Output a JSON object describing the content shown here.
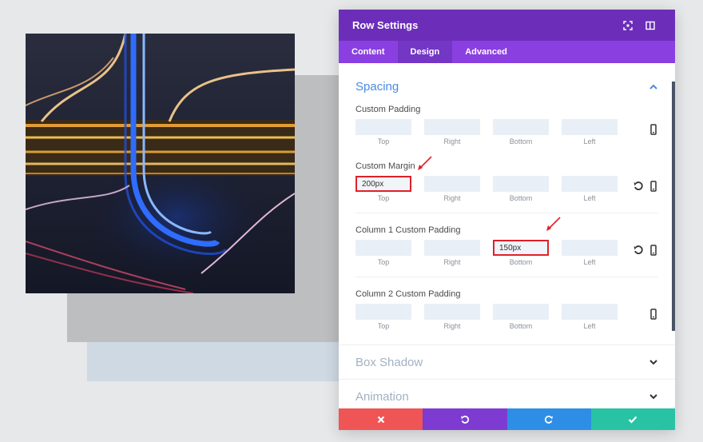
{
  "modal": {
    "title": "Row Settings",
    "tabs": [
      {
        "label": "Content",
        "active": false
      },
      {
        "label": "Design",
        "active": true
      },
      {
        "label": "Advanced",
        "active": false
      }
    ]
  },
  "spacing": {
    "title": "Spacing",
    "groups": {
      "custom_padding": {
        "label": "Custom Padding",
        "fields": [
          {
            "value": "",
            "sub": "Top"
          },
          {
            "value": "",
            "sub": "Right"
          },
          {
            "value": "",
            "sub": "Bottom"
          },
          {
            "value": "",
            "sub": "Left"
          }
        ]
      },
      "custom_margin": {
        "label": "Custom Margin",
        "fields": [
          {
            "value": "200px",
            "sub": "Top"
          },
          {
            "value": "",
            "sub": "Right"
          },
          {
            "value": "",
            "sub": "Bottom"
          },
          {
            "value": "",
            "sub": "Left"
          }
        ]
      },
      "column1_padding": {
        "label": "Column 1 Custom Padding",
        "fields": [
          {
            "value": "",
            "sub": "Top"
          },
          {
            "value": "",
            "sub": "Right"
          },
          {
            "value": "150px",
            "sub": "Bottom"
          },
          {
            "value": "",
            "sub": "Left"
          }
        ]
      },
      "column2_padding": {
        "label": "Column 2 Custom Padding",
        "fields": [
          {
            "value": "",
            "sub": "Top"
          },
          {
            "value": "",
            "sub": "Right"
          },
          {
            "value": "",
            "sub": "Bottom"
          },
          {
            "value": "",
            "sub": "Left"
          }
        ]
      }
    }
  },
  "box_shadow": {
    "title": "Box Shadow"
  },
  "animation": {
    "title": "Animation"
  },
  "icons": {
    "header": [
      "expand-icon",
      "sidebar-icon"
    ],
    "row": [
      "reset-icon",
      "phone-icon"
    ],
    "footer": [
      "close-icon",
      "undo-icon",
      "redo-icon",
      "check-icon"
    ]
  },
  "colors": {
    "header": "#6c2eb9",
    "tabs": "#8a3fe0",
    "accent": "#4a8be2",
    "cancel": "#ef5555",
    "undo": "#7d3bd1",
    "redo": "#2e8ee6",
    "save": "#28c2a4",
    "highlight": "#e0202a"
  }
}
